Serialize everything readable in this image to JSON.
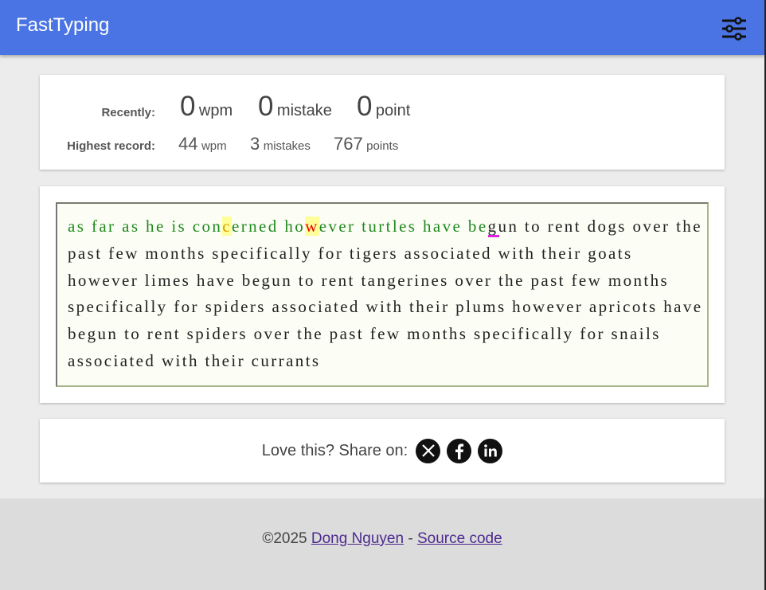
{
  "app": {
    "title": "FastTyping"
  },
  "icons": {
    "settings": "sliders-icon",
    "x": "x-logo-icon",
    "facebook": "facebook-icon",
    "linkedin": "linkedin-icon"
  },
  "colors": {
    "accent": "#4a73e3",
    "typed": "#1f8a1f",
    "error": "#e00000",
    "error_highlight": "#ffff99",
    "cursor": "#e020e0"
  },
  "stats": {
    "recent": {
      "label": "Recently:",
      "wpm": "0",
      "wpm_unit": "wpm",
      "mistakes": "0",
      "mistakes_unit": "mistake",
      "points": "0",
      "points_unit": "point"
    },
    "best": {
      "label": "Highest record:",
      "wpm": "44",
      "wpm_unit": "wpm",
      "mistakes": "3",
      "mistakes_unit": "mistakes",
      "points": "767",
      "points_unit": "points"
    }
  },
  "typing": {
    "typed_1": "as far as he is con",
    "err_1": "c",
    "typed_2": "erned ho",
    "err_2": "w",
    "typed_3": "ever turtles have be",
    "current_char": "g",
    "remaining": "un to rent dogs over the past few months specifically for tigers associated with their goats however limes have begun to rent tangerines over the past few months specifically for spiders associated with their plums however apricots have begun to rent spiders over the past few months specifically for snails associated with their currants"
  },
  "share": {
    "label": "Love this? Share on:"
  },
  "footer": {
    "copyright": "©2025 ",
    "author": "Dong Nguyen",
    "separator": " - ",
    "source": "Source code"
  }
}
